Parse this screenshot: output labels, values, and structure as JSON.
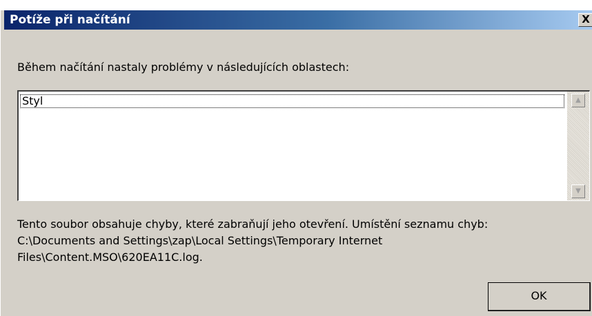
{
  "dialog": {
    "title": "Potíže při načítání",
    "close_label": "X",
    "message": "Během načítání nastaly problémy v následujících oblastech:",
    "list_items": [
      "Styl"
    ],
    "info_lines": [
      "Tento soubor obsahuje chyby, které zabraňují jeho otevření. Umístění seznamu chyb:",
      "C:\\Documents and Settings\\zap\\Local Settings\\Temporary Internet",
      "Files\\Content.MSO\\620EA11C.log."
    ],
    "ok_label": "OK"
  },
  "colors": {
    "titlebar_start": "#0a246a",
    "titlebar_end": "#a6caf0",
    "dialog_bg": "#d4d0c8"
  },
  "icons": {
    "scroll_up": "triangle-up-icon",
    "scroll_down": "triangle-down-icon"
  }
}
